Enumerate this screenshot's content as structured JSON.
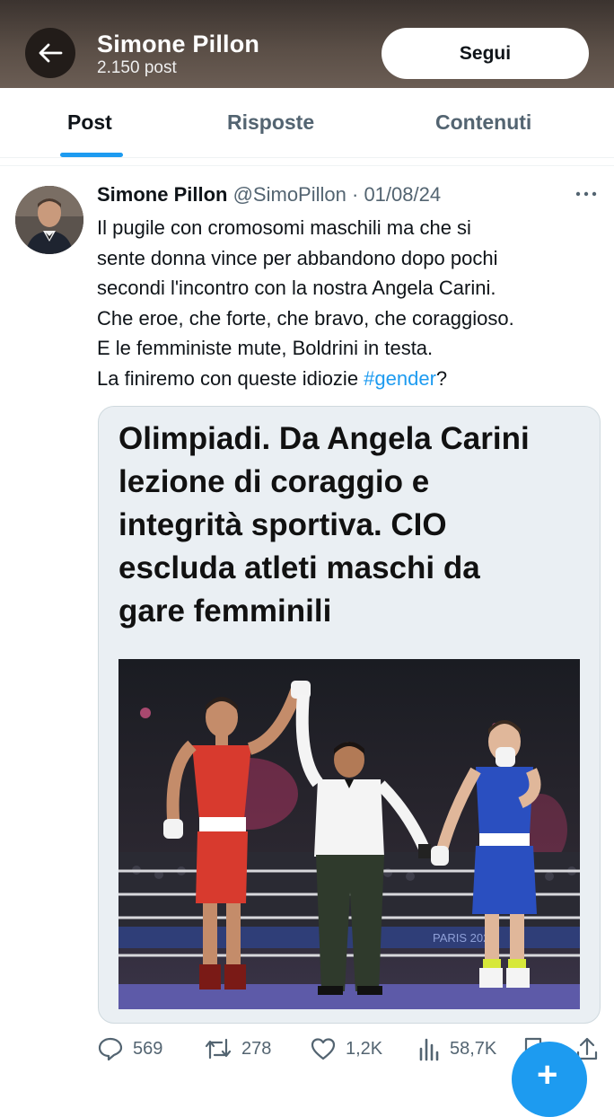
{
  "header": {
    "name": "Simone Pillon",
    "post_count": "2.150 post",
    "follow_label": "Segui"
  },
  "tabs": [
    {
      "label": "Post",
      "active": true
    },
    {
      "label": "Risposte",
      "active": false
    },
    {
      "label": "Contenuti",
      "active": false
    }
  ],
  "post": {
    "author": "Simone Pillon",
    "handle": "@SimoPillon",
    "separator": "·",
    "date": "01/08/24",
    "text_lines": [
      "Il pugile con cromosomi maschili ma che si",
      "sente donna vince per abbandono dopo pochi",
      "secondi l'incontro con la nostra Angela Carini.",
      "Che eroe, che forte, che bravo, che coraggioso.",
      "E le femministe mute, Boldrini in testa.",
      "La finiremo con queste idiozie "
    ],
    "hashtag": "#gender",
    "text_end": "?",
    "card": {
      "headline_lines": [
        "Olimpiadi. Da Angela Carini",
        "lezione di coraggio e",
        "integrità sportiva. CIO",
        "escluda atleti maschi da",
        "gare femminili"
      ],
      "photo_banner": "PARIS 2024"
    },
    "actions": {
      "replies": "569",
      "reposts": "278",
      "likes": "1,2K",
      "views": "58,7K"
    }
  },
  "colors": {
    "accent": "#1d9bf0",
    "text_secondary": "#536471",
    "header_bg": "#4a3f39"
  }
}
